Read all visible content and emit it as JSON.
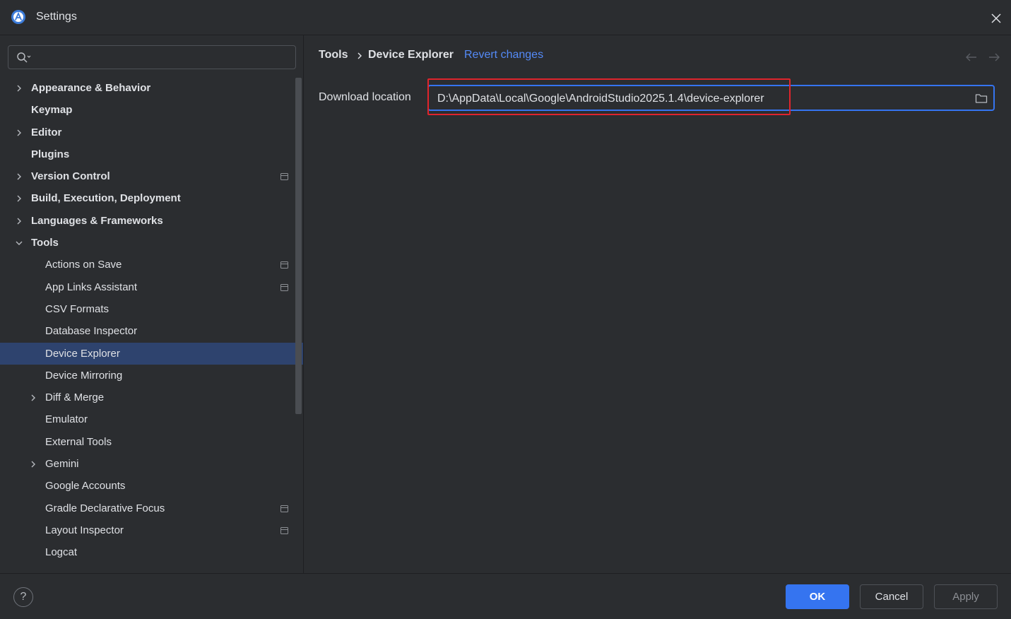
{
  "window": {
    "title": "Settings"
  },
  "search": {
    "value": "",
    "placeholder": ""
  },
  "tree": [
    {
      "label": "Appearance & Behavior",
      "level": 0,
      "expandable": true,
      "expanded": false,
      "project": false
    },
    {
      "label": "Keymap",
      "level": 0,
      "expandable": false,
      "project": false
    },
    {
      "label": "Editor",
      "level": 0,
      "expandable": true,
      "expanded": false,
      "project": false
    },
    {
      "label": "Plugins",
      "level": 0,
      "expandable": false,
      "project": false
    },
    {
      "label": "Version Control",
      "level": 0,
      "expandable": true,
      "expanded": false,
      "project": true
    },
    {
      "label": "Build, Execution, Deployment",
      "level": 0,
      "expandable": true,
      "expanded": false,
      "project": false
    },
    {
      "label": "Languages & Frameworks",
      "level": 0,
      "expandable": true,
      "expanded": false,
      "project": false
    },
    {
      "label": "Tools",
      "level": 0,
      "expandable": true,
      "expanded": true,
      "project": false
    },
    {
      "label": "Actions on Save",
      "level": 1,
      "expandable": false,
      "project": true
    },
    {
      "label": "App Links Assistant",
      "level": 1,
      "expandable": false,
      "project": true
    },
    {
      "label": "CSV Formats",
      "level": 1,
      "expandable": false,
      "project": false
    },
    {
      "label": "Database Inspector",
      "level": 1,
      "expandable": false,
      "project": false
    },
    {
      "label": "Device Explorer",
      "level": 1,
      "expandable": false,
      "project": false,
      "selected": true
    },
    {
      "label": "Device Mirroring",
      "level": 1,
      "expandable": false,
      "project": false
    },
    {
      "label": "Diff & Merge",
      "level": 1,
      "expandable": true,
      "expanded": false,
      "project": false
    },
    {
      "label": "Emulator",
      "level": 1,
      "expandable": false,
      "project": false
    },
    {
      "label": "External Tools",
      "level": 1,
      "expandable": false,
      "project": false
    },
    {
      "label": "Gemini",
      "level": 1,
      "expandable": true,
      "expanded": false,
      "project": false
    },
    {
      "label": "Google Accounts",
      "level": 1,
      "expandable": false,
      "project": false
    },
    {
      "label": "Gradle Declarative Focus",
      "level": 1,
      "expandable": false,
      "project": true
    },
    {
      "label": "Layout Inspector",
      "level": 1,
      "expandable": false,
      "project": true
    },
    {
      "label": "Logcat",
      "level": 1,
      "expandable": false,
      "project": false
    }
  ],
  "breadcrumb": {
    "parent": "Tools",
    "current": "Device Explorer",
    "revert": "Revert changes"
  },
  "field": {
    "label": "Download location",
    "value": "D:\\AppData\\Local\\Google\\AndroidStudio2025.1.4\\device-explorer"
  },
  "footer": {
    "help": "?",
    "ok": "OK",
    "cancel": "Cancel",
    "apply": "Apply"
  },
  "colors": {
    "accent": "#3574f0",
    "selection": "#2e436e",
    "link": "#548af7",
    "highlight": "#e0242c",
    "background": "#2b2d30"
  },
  "icons": {
    "app": "android-studio-icon",
    "close": "close-icon",
    "search": "search-icon",
    "folder": "folder-icon",
    "project": "project-scope-icon",
    "back": "arrow-back-icon",
    "forward": "arrow-forward-icon"
  }
}
